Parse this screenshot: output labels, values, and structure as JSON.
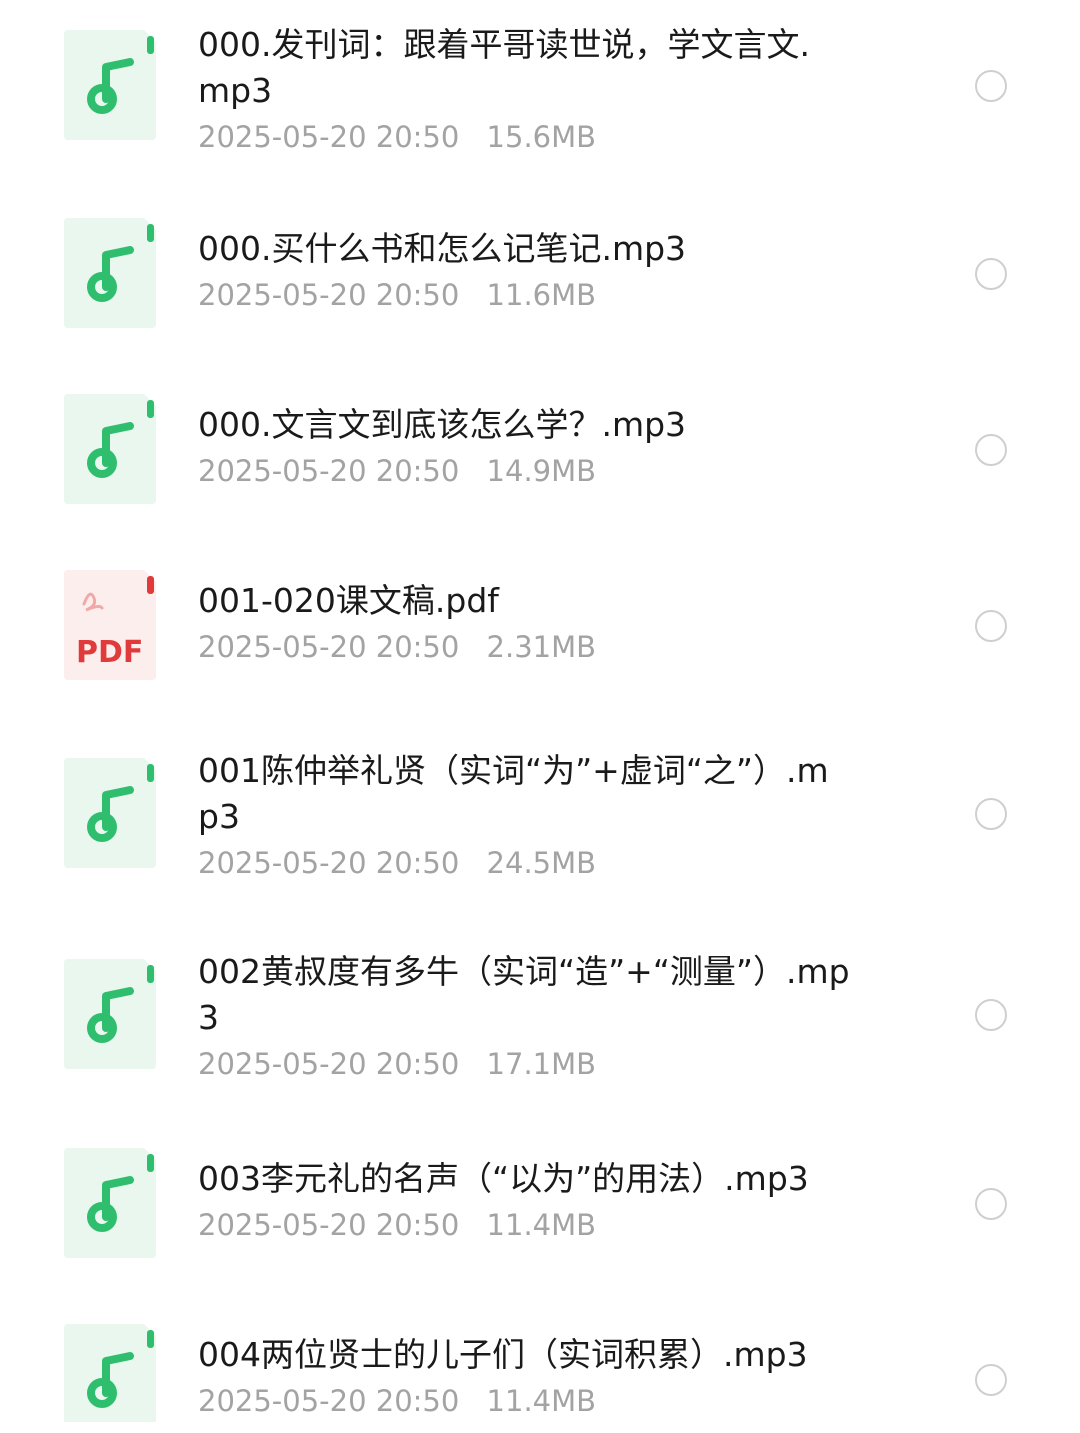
{
  "files": [
    {
      "type": "audio",
      "icon": "music-note-icon",
      "name_lines": [
        "000.发刊词：跟着平哥读世说，学文言文.",
        "mp3"
      ],
      "date": "2025-05-20 20:50",
      "size": "15.6MB"
    },
    {
      "type": "audio",
      "icon": "music-note-icon",
      "name_lines": [
        "000.买什么书和怎么记笔记.mp3"
      ],
      "date": "2025-05-20 20:50",
      "size": "11.6MB"
    },
    {
      "type": "audio",
      "icon": "music-note-icon",
      "name_lines": [
        "000.文言文到底该怎么学？.mp3"
      ],
      "date": "2025-05-20 20:50",
      "size": "14.9MB"
    },
    {
      "type": "pdf",
      "icon": "pdf-icon",
      "icon_label": "PDF",
      "name_lines": [
        "001-020课文稿.pdf"
      ],
      "date": "2025-05-20 20:50",
      "size": "2.31MB"
    },
    {
      "type": "audio",
      "icon": "music-note-icon",
      "name_lines": [
        "001陈仲举礼贤（实词“为”+虚词“之”）.m",
        "p3"
      ],
      "date": "2025-05-20 20:50",
      "size": "24.5MB"
    },
    {
      "type": "audio",
      "icon": "music-note-icon",
      "name_lines": [
        "002黄叔度有多牛（实词“造”+“测量”）.mp",
        "3"
      ],
      "date": "2025-05-20 20:50",
      "size": "17.1MB"
    },
    {
      "type": "audio",
      "icon": "music-note-icon",
      "name_lines": [
        "003李元礼的名声（“以为”的用法）.mp3"
      ],
      "date": "2025-05-20 20:50",
      "size": "11.4MB"
    },
    {
      "type": "audio",
      "icon": "music-note-icon",
      "name_lines": [
        "004两位贤士的儿子们（实词积累）.mp3"
      ],
      "date": "2025-05-20 20:50",
      "size": "11.4MB"
    }
  ],
  "colors": {
    "audio_accent": "#2fbe6e",
    "audio_bg": "#eaf7ef",
    "pdf_accent": "#e03a3a",
    "pdf_bg": "#fdeeee",
    "name_text": "#1a1a1a",
    "meta_text": "#a3a3a3",
    "radio_border": "#cfcfcf"
  }
}
